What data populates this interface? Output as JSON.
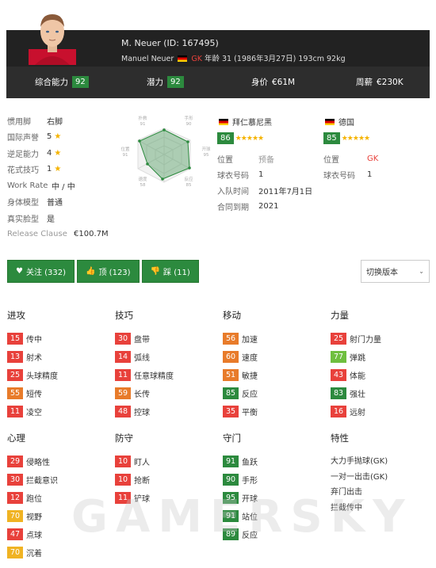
{
  "header": {
    "title": "M. Neuer (ID: 167495)",
    "full_name": "Manuel Neuer",
    "position": "GK",
    "details": "年龄 31 (1986年3月27日) 193cm 92kg"
  },
  "stats_bar": {
    "overall_label": "综合能力",
    "overall_value": "92",
    "potential_label": "潜力",
    "potential_value": "92",
    "value_label": "身价",
    "value_value": "€61M",
    "wage_label": "周薪",
    "wage_value": "€230K"
  },
  "attributes": [
    {
      "label": "惯用脚",
      "value": "右脚"
    },
    {
      "label": "国际声誉",
      "value": "5",
      "star": true
    },
    {
      "label": "逆足能力",
      "value": "4",
      "star": true
    },
    {
      "label": "花式技巧",
      "value": "1",
      "star": true
    },
    {
      "label": "Work Rate",
      "value": "中 / 中"
    },
    {
      "label": "身体模型",
      "value": "普通"
    },
    {
      "label": "真实脸型",
      "value": "是"
    },
    {
      "label": "Release Clause",
      "value": "€100.7M"
    }
  ],
  "radar": {
    "labels": [
      "扑救",
      "手形",
      "开球",
      "反应",
      "速度",
      "位置"
    ],
    "values": [
      "91",
      "90",
      "95",
      "85",
      "58",
      "91"
    ]
  },
  "club": {
    "name": "拜仁慕尼黑",
    "rating": "86",
    "rows": [
      {
        "label": "位置",
        "value": "预备"
      },
      {
        "label": "球衣号码",
        "value": "1"
      },
      {
        "label": "入队时间",
        "value": "2011年7月1日"
      },
      {
        "label": "合同到期",
        "value": "2021"
      }
    ]
  },
  "national": {
    "name": "德国",
    "rating": "85",
    "rows": [
      {
        "label": "位置",
        "value": "GK"
      },
      {
        "label": "球衣号码",
        "value": "1"
      }
    ]
  },
  "buttons": {
    "follow": "关注 (332)",
    "like": "顶 (123)",
    "dislike": "踩 (11)",
    "version": "切换版本"
  },
  "columns": [
    {
      "title": "进攻",
      "items": [
        {
          "v": "15",
          "c": "#e8413b",
          "n": "传中"
        },
        {
          "v": "13",
          "c": "#e8413b",
          "n": "射术"
        },
        {
          "v": "25",
          "c": "#e8413b",
          "n": "头球精度"
        },
        {
          "v": "55",
          "c": "#e87b2a",
          "n": "短传"
        },
        {
          "v": "11",
          "c": "#e8413b",
          "n": "凌空"
        }
      ]
    },
    {
      "title": "技巧",
      "items": [
        {
          "v": "30",
          "c": "#e8413b",
          "n": "盘带"
        },
        {
          "v": "14",
          "c": "#e8413b",
          "n": "弧线"
        },
        {
          "v": "11",
          "c": "#e8413b",
          "n": "任意球精度"
        },
        {
          "v": "59",
          "c": "#e87b2a",
          "n": "长传"
        },
        {
          "v": "48",
          "c": "#e8413b",
          "n": "控球"
        }
      ]
    },
    {
      "title": "移动",
      "items": [
        {
          "v": "56",
          "c": "#e87b2a",
          "n": "加速"
        },
        {
          "v": "60",
          "c": "#e87b2a",
          "n": "速度"
        },
        {
          "v": "51",
          "c": "#e87b2a",
          "n": "敏捷"
        },
        {
          "v": "85",
          "c": "#2c8a3e",
          "n": "反应"
        },
        {
          "v": "35",
          "c": "#e8413b",
          "n": "平衡"
        }
      ]
    },
    {
      "title": "力量",
      "items": [
        {
          "v": "25",
          "c": "#e8413b",
          "n": "射门力量"
        },
        {
          "v": "77",
          "c": "#6fbf3f",
          "n": "弹跳"
        },
        {
          "v": "43",
          "c": "#e8413b",
          "n": "体能"
        },
        {
          "v": "83",
          "c": "#2c8a3e",
          "n": "强壮"
        },
        {
          "v": "16",
          "c": "#e8413b",
          "n": "远射"
        }
      ]
    },
    {
      "title": "心理",
      "items": [
        {
          "v": "29",
          "c": "#e8413b",
          "n": "侵略性"
        },
        {
          "v": "30",
          "c": "#e8413b",
          "n": "拦截意识"
        },
        {
          "v": "12",
          "c": "#e8413b",
          "n": "跑位"
        },
        {
          "v": "70",
          "c": "#f0b323",
          "n": "视野"
        },
        {
          "v": "47",
          "c": "#e8413b",
          "n": "点球"
        },
        {
          "v": "70",
          "c": "#f0b323",
          "n": "沉着"
        }
      ]
    },
    {
      "title": "防守",
      "items": [
        {
          "v": "10",
          "c": "#e8413b",
          "n": "盯人"
        },
        {
          "v": "10",
          "c": "#e8413b",
          "n": "抢断"
        },
        {
          "v": "11",
          "c": "#e8413b",
          "n": "铲球"
        }
      ]
    },
    {
      "title": "守门",
      "items": [
        {
          "v": "91",
          "c": "#2c8a3e",
          "n": "鱼跃"
        },
        {
          "v": "90",
          "c": "#2c8a3e",
          "n": "手形"
        },
        {
          "v": "95",
          "c": "#2c8a3e",
          "n": "开球"
        },
        {
          "v": "91",
          "c": "#2c8a3e",
          "n": "站位"
        },
        {
          "v": "89",
          "c": "#2c8a3e",
          "n": "反应"
        }
      ]
    }
  ],
  "traits": {
    "title": "特性",
    "items": [
      "大力手抛球(GK)",
      "一对一出击(GK)",
      "弃门出击",
      "拦截传中"
    ]
  },
  "watermark": "GAMERSKY"
}
